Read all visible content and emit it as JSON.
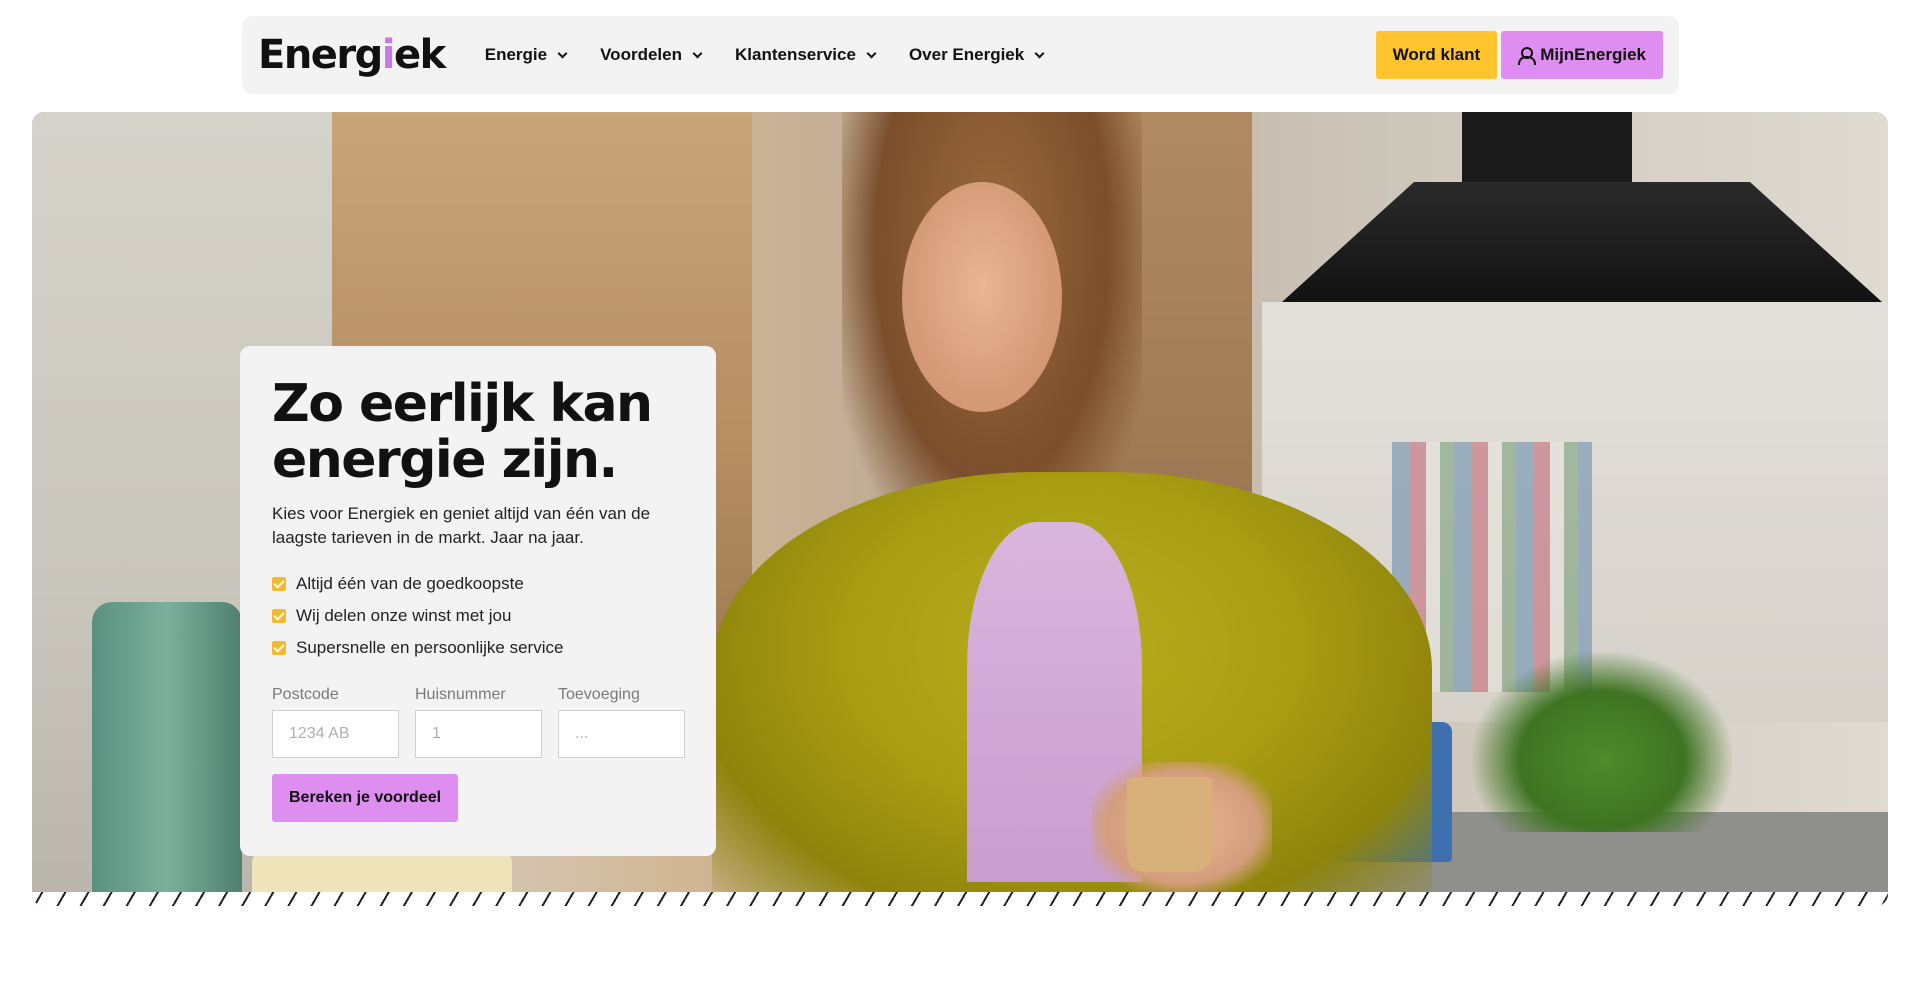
{
  "nav": {
    "logo": {
      "prefix": "Energ",
      "accent": "i",
      "suffix": "ek"
    },
    "menu": [
      {
        "label": "Energie"
      },
      {
        "label": "Voordelen"
      },
      {
        "label": "Klantenservice"
      },
      {
        "label": "Over Energiek"
      }
    ],
    "word_klant": "Word klant",
    "mijn_energiek": "MijnEnergiek"
  },
  "hero": {
    "title_line1": "Zo eerlijk kan",
    "title_line2": "energie zijn.",
    "lead": "Kies voor Energiek en geniet altijd van één van de laagste tarieven in de markt. Jaar na jaar.",
    "checks": [
      "Altijd één van de goedkoopste",
      "Wij delen onze winst met jou",
      "Supersnelle en persoonlijke service"
    ],
    "form": {
      "postcode_label": "Postcode",
      "postcode_placeholder": "1234 AB",
      "huisnummer_label": "Huisnummer",
      "huisnummer_placeholder": "1",
      "toevoeging_label": "Toevoeging",
      "toevoeging_placeholder": "...",
      "submit_label": "Bereken je voordeel"
    }
  },
  "colors": {
    "yellow": "#ffc42e",
    "pink": "#dd8ef0",
    "check": "#f5b92c"
  }
}
